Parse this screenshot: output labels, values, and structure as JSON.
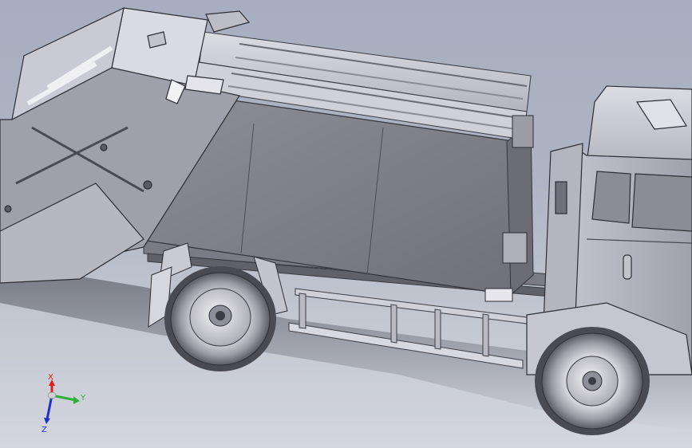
{
  "viewport": {
    "background_top": "#a6aebf",
    "background_bottom": "#d3d6de"
  },
  "model": {
    "subject": "garbage-compactor-truck",
    "parts": [
      "cab",
      "compactor-body",
      "tailgate-hopper",
      "rear-wheel",
      "front-wheel",
      "side-guard-rail",
      "chassis-frame"
    ]
  },
  "triad": {
    "x_label": "X",
    "y_label": "Y",
    "z_label": "Z",
    "x_color": "#e0201a",
    "y_color": "#2fae3a",
    "z_color": "#2330c8"
  }
}
